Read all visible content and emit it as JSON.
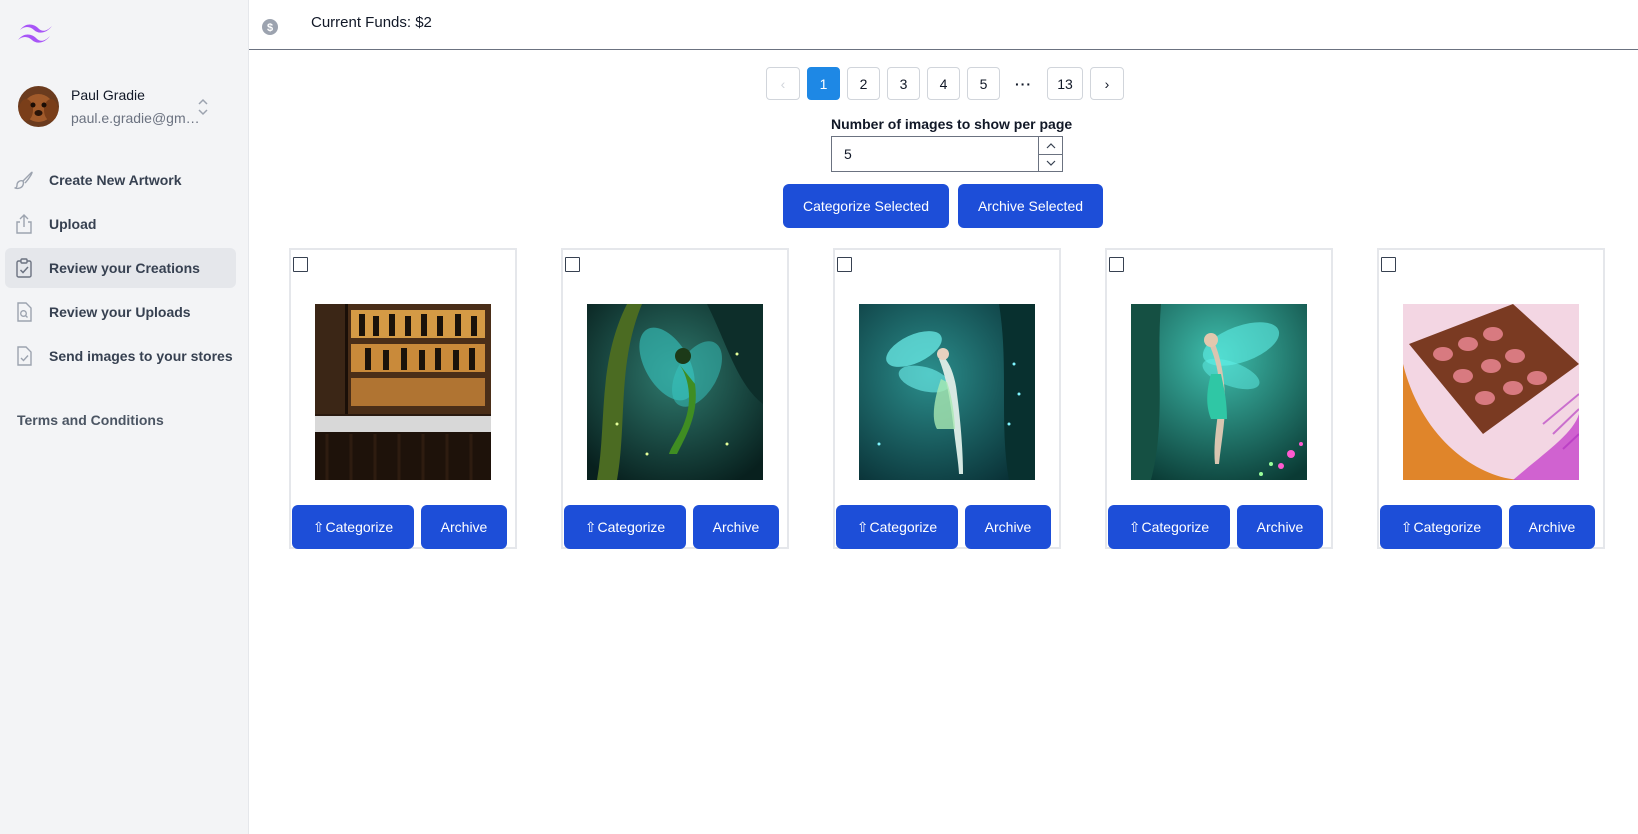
{
  "sidebar": {
    "user": {
      "name": "Paul Gradie",
      "email": "paul.e.gradie@gmail.com"
    },
    "items": [
      {
        "label": "Create New Artwork",
        "icon": "brush-icon",
        "active": false
      },
      {
        "label": "Upload",
        "icon": "upload-icon",
        "active": false
      },
      {
        "label": "Review your Creations",
        "icon": "clipboard-check-icon",
        "active": true
      },
      {
        "label": "Review your Uploads",
        "icon": "document-search-icon",
        "active": false
      },
      {
        "label": "Send images to your stores",
        "icon": "document-check-icon",
        "active": false
      }
    ],
    "terms": "Terms and Conditions"
  },
  "topbar": {
    "funds": "Current Funds: $2",
    "icon": "coin-icon"
  },
  "pagination": {
    "prev": "‹",
    "pages": [
      "1",
      "2",
      "3",
      "4",
      "5"
    ],
    "current": "1",
    "ellipsis": "···",
    "last": "13",
    "next": "›"
  },
  "per_page": {
    "label": "Number of images to show per page",
    "value": "5"
  },
  "actions": {
    "categorize_selected": "Categorize Selected",
    "archive_selected": "Archive Selected"
  },
  "cards": [
    {
      "categorize": "Categorize",
      "archive": "Archive"
    },
    {
      "categorize": "Categorize",
      "archive": "Archive"
    },
    {
      "categorize": "Categorize",
      "archive": "Archive"
    },
    {
      "categorize": "Categorize",
      "archive": "Archive"
    },
    {
      "categorize": "Categorize",
      "archive": "Archive"
    }
  ],
  "colors": {
    "primary": "#1d4ed8",
    "page_active": "#1e88e5",
    "sidebar_bg": "#f3f4f6",
    "logo": "#a855f7"
  }
}
